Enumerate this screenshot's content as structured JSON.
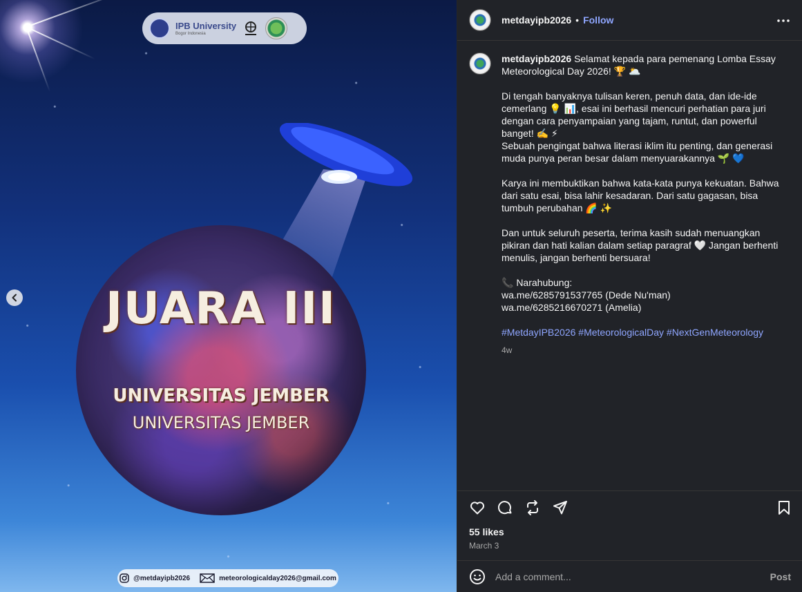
{
  "media": {
    "sponsor": {
      "ipb_name": "IPB University",
      "ipb_sub": "Bogor Indonesia",
      "himagreto": "HIMAGRETO"
    },
    "juara": "JUARA III",
    "university_line1": "UNIVERSITAS JEMBER",
    "university_line2": "UNIVERSITAS JEMBER",
    "instagram": "@metdayipb2026",
    "email": "meteorologicalday2026@gmail.com"
  },
  "header": {
    "username": "metdayipb2026",
    "dot": "•",
    "follow": "Follow"
  },
  "caption": {
    "username": "metdayipb2026",
    "line1": "Selamat kepada para pemenang Lomba Essay Meteorological Day 2026! 🏆 🌥️",
    "para2": "Di tengah banyaknya tulisan keren, penuh data, dan ide-ide cemerlang 💡 📊, esai ini berhasil mencuri perhatian para juri dengan cara penyampaian yang tajam, runtut, dan powerful banget! ✍️ ⚡",
    "para2b": "Sebuah pengingat bahwa literasi iklim itu penting, dan generasi muda punya peran besar dalam menyuarakannya 🌱 💙",
    "para3": "Karya ini membuktikan bahwa kata-kata punya kekuatan. Bahwa dari satu esai, bisa lahir kesadaran. Dari satu gagasan, bisa tumbuh perubahan 🌈 ✨",
    "para4": "Dan untuk seluruh peserta, terima kasih sudah menuangkan pikiran dan hati kalian dalam setiap paragraf 🤍 Jangan berhenti menulis, jangan berhenti bersuara!",
    "contact_label": "📞 Narahubung:",
    "contact1": "wa.me/6285791537765 (Dede Nu'man)",
    "contact2": "wa.me/6285216670271 (Amelia)",
    "hashtags": [
      "#MetdayIPB2026",
      "#MeteorologicalDay",
      "#NextGenMeteorology"
    ],
    "time_ago": "4w"
  },
  "engagement": {
    "likes": "55 likes",
    "date": "March 3"
  },
  "comment": {
    "placeholder": "Add a comment...",
    "post": "Post"
  },
  "colors": {
    "panel_bg": "#212328",
    "link": "#8fa6ff",
    "muted": "#a8a8a8",
    "text": "#f5f5f5"
  },
  "icons": [
    "chevron-left-icon",
    "more-icon",
    "heart-icon",
    "comment-icon",
    "repost-icon",
    "share-icon",
    "bookmark-icon",
    "emoji-icon",
    "instagram-icon",
    "mail-icon"
  ]
}
